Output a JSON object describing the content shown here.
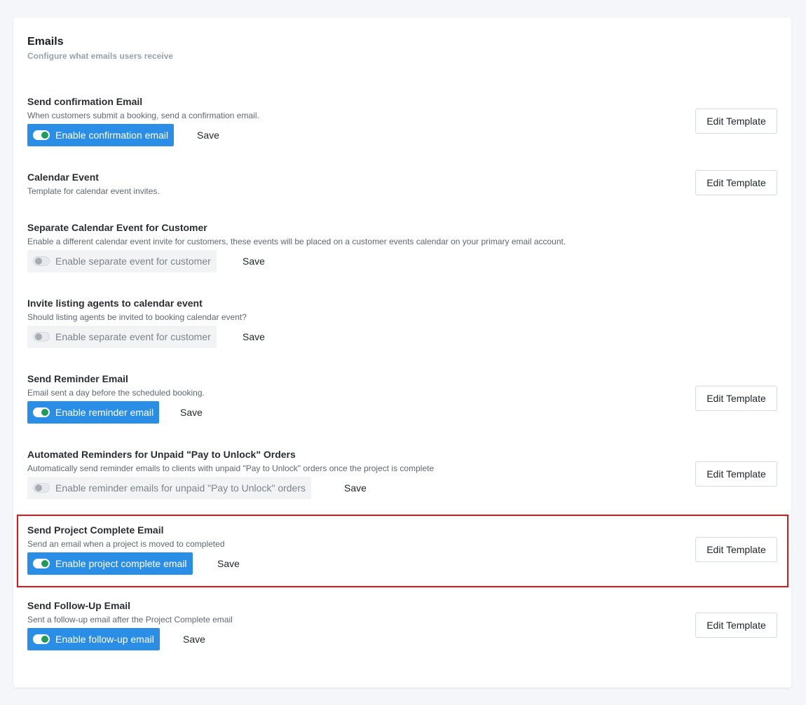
{
  "section": {
    "title": "Emails",
    "subtitle": "Configure what emails users receive"
  },
  "rows": [
    {
      "title": "Send confirmation Email",
      "description": "When customers submit a booking, send a confirmation email.",
      "toggle_label": "Enable confirmation email",
      "enabled": true,
      "save_label": "Save",
      "edit_label": "Edit Template"
    },
    {
      "title": "Calendar Event",
      "description": "Template for calendar event invites.",
      "edit_label": "Edit Template"
    },
    {
      "title": "Separate Calendar Event for Customer",
      "description": "Enable a different calendar event invite for customers, these events will be placed on a customer events calendar on your primary email account.",
      "toggle_label": "Enable separate event for customer",
      "enabled": false,
      "save_label": "Save"
    },
    {
      "title": "Invite listing agents to calendar event",
      "description": "Should listing agents be invited to booking calendar event?",
      "toggle_label": "Enable separate event for customer",
      "enabled": false,
      "save_label": "Save"
    },
    {
      "title": "Send Reminder Email",
      "description": "Email sent a day before the scheduled booking.",
      "toggle_label": "Enable reminder email",
      "enabled": true,
      "save_label": "Save",
      "edit_label": "Edit Template"
    },
    {
      "title": "Automated Reminders for Unpaid \"Pay to Unlock\" Orders",
      "description": "Automatically send reminder emails to clients with unpaid \"Pay to Unlock\" orders once the project is complete",
      "toggle_label": "Enable reminder emails for unpaid \"Pay to Unlock\" orders",
      "enabled": false,
      "save_label": "Save",
      "edit_label": "Edit Template"
    },
    {
      "title": "Send Project Complete Email",
      "description": "Send an email when a project is moved to completed",
      "toggle_label": "Enable project complete email",
      "enabled": true,
      "save_label": "Save",
      "edit_label": "Edit Template",
      "highlighted": true
    },
    {
      "title": "Send Follow-Up Email",
      "description": "Sent a follow-up email after the Project Complete email",
      "toggle_label": "Enable follow-up email",
      "enabled": true,
      "save_label": "Save",
      "edit_label": "Edit Template"
    }
  ],
  "colors": {
    "accent": "#2b8ee6",
    "switch_on_knob": "#1e9b5a",
    "highlight_border": "#e01515"
  }
}
